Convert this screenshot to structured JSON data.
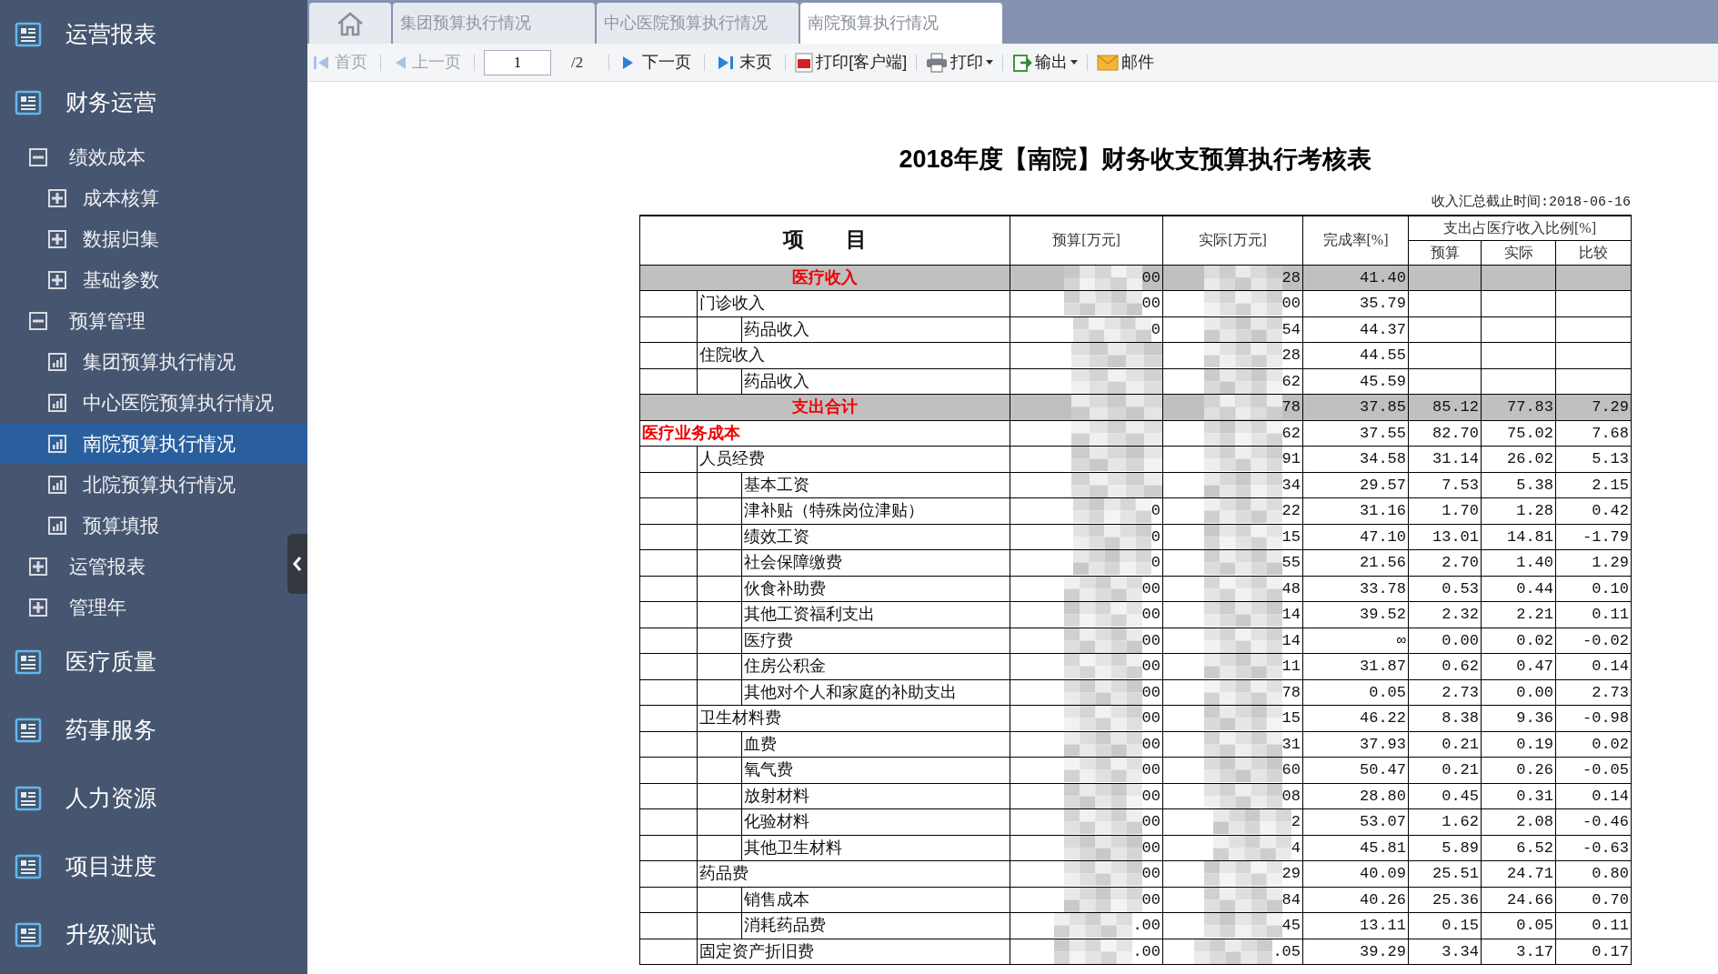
{
  "sidebar": {
    "items": [
      {
        "label": "运营报表"
      },
      {
        "label": "财务运营",
        "children": [
          {
            "label": "绩效成本",
            "expanded": true,
            "children": [
              {
                "label": "成本核算",
                "kind": "folder",
                "expanded": false,
                "selected": false
              },
              {
                "label": "数据归集",
                "kind": "folder",
                "expanded": false,
                "selected": false
              },
              {
                "label": "基础参数",
                "kind": "folder",
                "expanded": false,
                "selected": false
              }
            ]
          },
          {
            "label": "预算管理",
            "expanded": true,
            "children": [
              {
                "label": "集团预算执行情况",
                "kind": "report",
                "selected": false
              },
              {
                "label": "中心医院预算执行情况",
                "kind": "report",
                "selected": false
              },
              {
                "label": "南院预算执行情况",
                "kind": "report",
                "selected": true
              },
              {
                "label": "北院预算执行情况",
                "kind": "report",
                "selected": false
              },
              {
                "label": "预算填报",
                "kind": "report",
                "selected": false
              }
            ]
          },
          {
            "label": "运管报表",
            "expanded": false
          },
          {
            "label": "管理年",
            "expanded": false
          }
        ]
      },
      {
        "label": "医疗质量"
      },
      {
        "label": "药事服务"
      },
      {
        "label": "人力资源"
      },
      {
        "label": "项目进度"
      },
      {
        "label": "升级测试"
      }
    ]
  },
  "tabs": [
    {
      "label": "集团预算执行情况",
      "selected": false
    },
    {
      "label": "中心医院预算执行情况",
      "selected": false
    },
    {
      "label": "南院预算执行情况",
      "selected": true
    }
  ],
  "toolbar": {
    "first": {
      "label": "首页",
      "disabled": true
    },
    "prev": {
      "label": "上一页",
      "disabled": true
    },
    "page": "1",
    "total": "/2",
    "next": {
      "label": "下一页",
      "disabled": false
    },
    "last": {
      "label": "末页",
      "disabled": false
    },
    "print_client": "打印[客户端]",
    "print": "打印",
    "export": "输出",
    "mail": "邮件"
  },
  "report": {
    "title": "2018年度【南院】财务收支预算执行考核表",
    "cutoff": "收入汇总截止时间:2018-06-16",
    "columns": {
      "item": "项　　目",
      "budget": "预算[万元]",
      "actual": "实际[万元]",
      "rate": "完成率[%]",
      "ratio": "支出占医疗收入比例[%]",
      "ratio_budget": "预算",
      "ratio_actual": "实际",
      "ratio_compare": "比较"
    },
    "rows": [
      {
        "item": "医疗收入",
        "kind": "total",
        "budget": "00",
        "actual": "28",
        "rate": "41.40",
        "children": [
          {
            "item": "门诊收入",
            "budget": "00",
            "actual": "00",
            "rate": "35.79",
            "children": [
              {
                "item": "药品收入",
                "budget": "0",
                "actual": "54",
                "rate": "44.37"
              }
            ]
          },
          {
            "item": "住院收入",
            "actual": "28",
            "rate": "44.55",
            "children": [
              {
                "item": "药品收入",
                "actual": "62",
                "rate": "45.59"
              }
            ]
          }
        ]
      },
      {
        "item": "支出合计",
        "kind": "total",
        "actual": "78",
        "rate": "37.85",
        "ratio_budget": "85.12",
        "ratio_actual": "77.83",
        "ratio_compare": "7.29"
      },
      {
        "item": "医疗业务成本",
        "kind": "category",
        "actual": "62",
        "rate": "37.55",
        "ratio_budget": "82.70",
        "ratio_actual": "75.02",
        "ratio_compare": "7.68",
        "children": [
          {
            "item": "人员经费",
            "actual": "91",
            "rate": "34.58",
            "ratio_budget": "31.14",
            "ratio_actual": "26.02",
            "ratio_compare": "5.13",
            "children": [
              {
                "item": "基本工资",
                "actual": "34",
                "rate": "29.57",
                "ratio_budget": "7.53",
                "ratio_actual": "5.38",
                "ratio_compare": "2.15"
              },
              {
                "item": "津补贴（特殊岗位津贴）",
                "budget": "0",
                "actual": "22",
                "rate": "31.16",
                "ratio_budget": "1.70",
                "ratio_actual": "1.28",
                "ratio_compare": "0.42"
              },
              {
                "item": "绩效工资",
                "budget": "0",
                "actual": "15",
                "rate": "47.10",
                "ratio_budget": "13.01",
                "ratio_actual": "14.81",
                "ratio_compare": "-1.79"
              },
              {
                "item": "社会保障缴费",
                "budget": "0",
                "actual": "55",
                "rate": "21.56",
                "ratio_budget": "2.70",
                "ratio_actual": "1.40",
                "ratio_compare": "1.29"
              },
              {
                "item": "伙食补助费",
                "budget": "00",
                "actual": "48",
                "rate": "33.78",
                "ratio_budget": "0.53",
                "ratio_actual": "0.44",
                "ratio_compare": "0.10"
              },
              {
                "item": "其他工资福利支出",
                "budget": "00",
                "actual": "14",
                "rate": "39.52",
                "ratio_budget": "2.32",
                "ratio_actual": "2.21",
                "ratio_compare": "0.11"
              },
              {
                "item": "医疗费",
                "budget": "00",
                "actual": "14",
                "rate": "∞",
                "ratio_budget": "0.00",
                "ratio_actual": "0.02",
                "ratio_compare": "-0.02"
              },
              {
                "item": "住房公积金",
                "budget": "00",
                "actual": "11",
                "rate": "31.87",
                "ratio_budget": "0.62",
                "ratio_actual": "0.47",
                "ratio_compare": "0.14"
              },
              {
                "item": "其他对个人和家庭的补助支出",
                "budget": "00",
                "actual": "78",
                "rate": "0.05",
                "ratio_budget": "2.73",
                "ratio_actual": "0.00",
                "ratio_compare": "2.73"
              }
            ]
          },
          {
            "item": "卫生材料费",
            "budget": "00",
            "actual": "15",
            "rate": "46.22",
            "ratio_budget": "8.38",
            "ratio_actual": "9.36",
            "ratio_compare": "-0.98",
            "children": [
              {
                "item": "血费",
                "budget": "00",
                "actual": "31",
                "rate": "37.93",
                "ratio_budget": "0.21",
                "ratio_actual": "0.19",
                "ratio_compare": "0.02"
              },
              {
                "item": "氧气费",
                "budget": "00",
                "actual": "60",
                "rate": "50.47",
                "ratio_budget": "0.21",
                "ratio_actual": "0.26",
                "ratio_compare": "-0.05"
              },
              {
                "item": "放射材料",
                "budget": "00",
                "actual": "08",
                "rate": "28.80",
                "ratio_budget": "0.45",
                "ratio_actual": "0.31",
                "ratio_compare": "0.14"
              },
              {
                "item": "化验材料",
                "budget": "00",
                "actual": "2",
                "rate": "53.07",
                "ratio_budget": "1.62",
                "ratio_actual": "2.08",
                "ratio_compare": "-0.46"
              },
              {
                "item": "其他卫生材料",
                "budget": "00",
                "actual": "4",
                "rate": "45.81",
                "ratio_budget": "5.89",
                "ratio_actual": "6.52",
                "ratio_compare": "-0.63"
              }
            ]
          },
          {
            "item": "药品费",
            "budget": "00",
            "actual": "29",
            "rate": "40.09",
            "ratio_budget": "25.51",
            "ratio_actual": "24.71",
            "ratio_compare": "0.80",
            "children": [
              {
                "item": "销售成本",
                "budget": "00",
                "actual": "84",
                "rate": "40.26",
                "ratio_budget": "25.36",
                "ratio_actual": "24.66",
                "ratio_compare": "0.70"
              },
              {
                "item": "消耗药品费",
                "budget": ".00",
                "actual": "45",
                "rate": "13.11",
                "ratio_budget": "0.15",
                "ratio_actual": "0.05",
                "ratio_compare": "0.11"
              }
            ]
          },
          {
            "item": "固定资产折旧费",
            "budget": ".00",
            "actual": ".05",
            "rate": "39.29",
            "ratio_budget": "3.34",
            "ratio_actual": "3.17",
            "ratio_compare": "0.17"
          }
        ]
      }
    ]
  }
}
